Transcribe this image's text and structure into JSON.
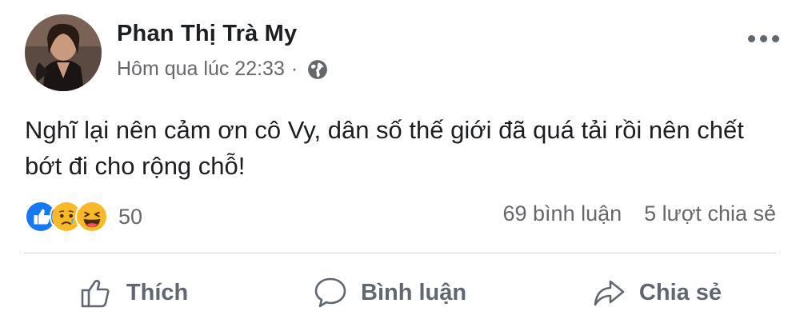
{
  "post": {
    "author": "Phan Thị Trà My",
    "time": "Hôm qua lúc 22:33",
    "separator": "·",
    "privacy_icon": "globe-icon",
    "text": "Nghĩ lại nên cảm ơn cô Vy, dân số thế giới đã quá tải rồi nên chết bớt đi cho rộng chỗ!"
  },
  "reactions": {
    "icons": [
      "like-reaction-icon",
      "sad-reaction-icon",
      "haha-reaction-icon"
    ],
    "count": "50"
  },
  "stats": {
    "comments": "69 bình luận",
    "shares": "5 lượt chia sẻ"
  },
  "actions": {
    "like": "Thích",
    "comment": "Bình luận",
    "share": "Chia sẻ"
  },
  "colors": {
    "text": "#1c1e21",
    "secondary": "#65676b",
    "action": "#606770",
    "divider": "#ced0d4",
    "like_blue": "#1877f2",
    "emoji_yellow": "#f7b928"
  }
}
